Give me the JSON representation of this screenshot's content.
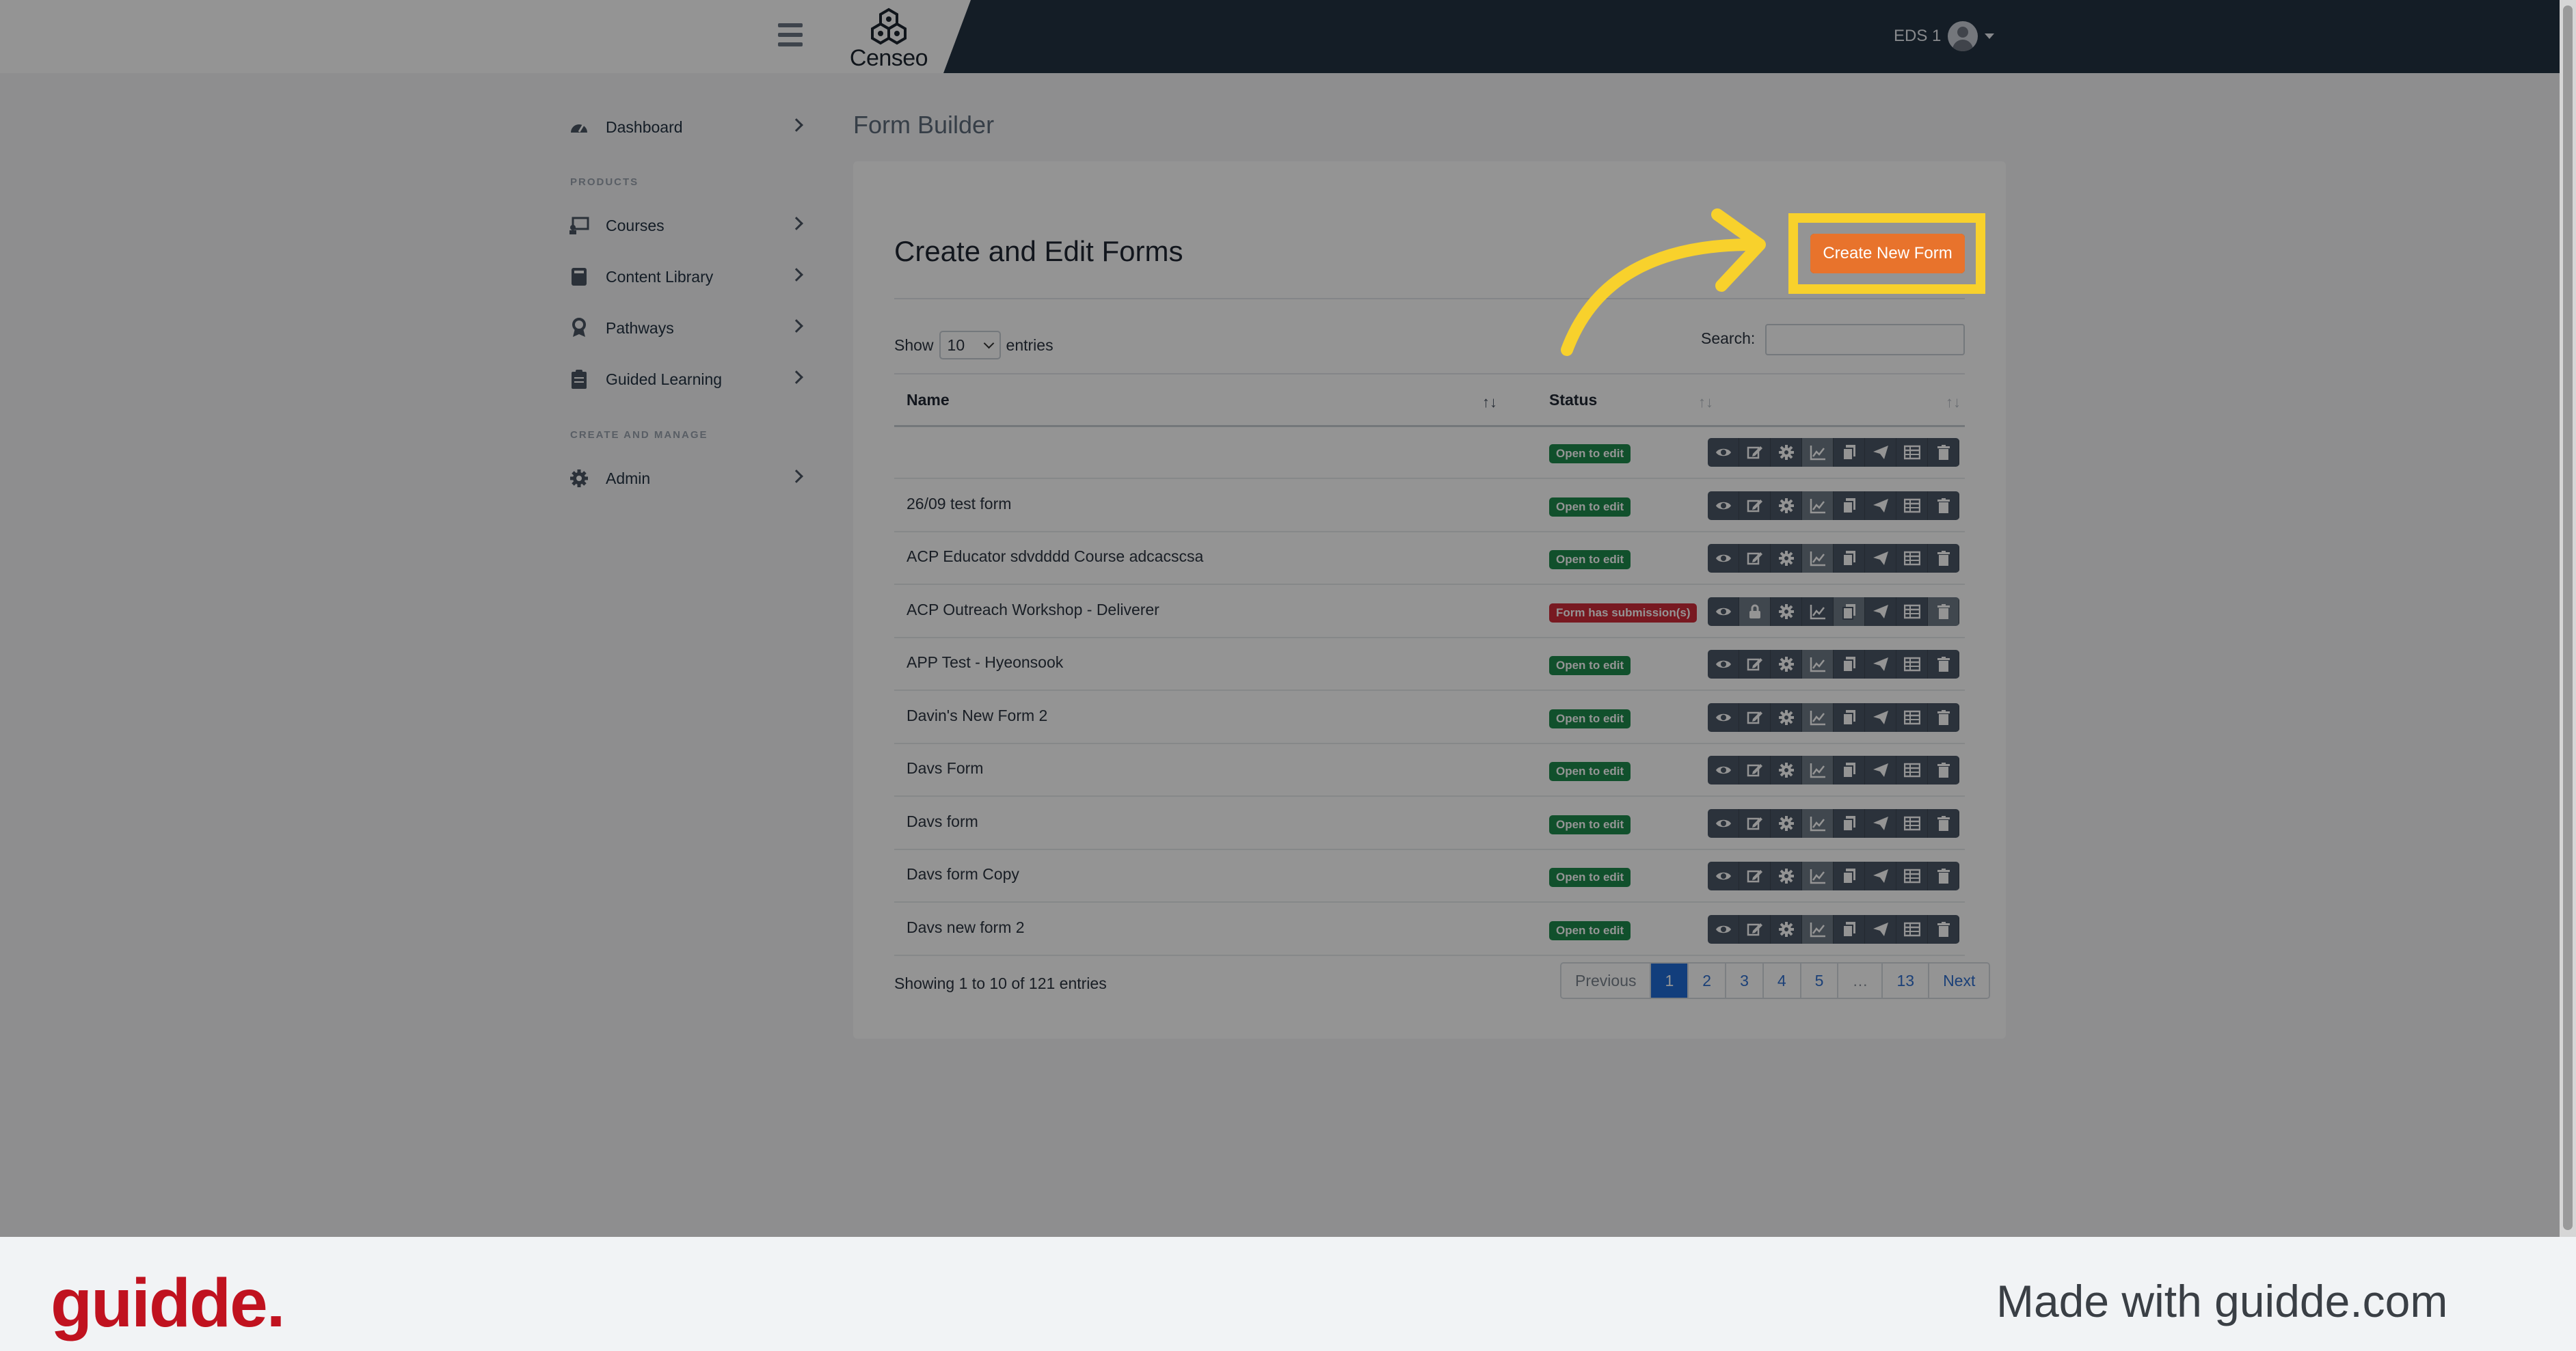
{
  "header": {
    "app_name": "Censeo",
    "user_name": "EDS 1"
  },
  "sidebar": {
    "items": [
      {
        "label": "Dashboard",
        "icon": "dashboard-icon"
      },
      {
        "section": "PRODUCTS"
      },
      {
        "label": "Courses",
        "icon": "courses-icon"
      },
      {
        "label": "Content Library",
        "icon": "book-icon"
      },
      {
        "label": "Pathways",
        "icon": "award-icon"
      },
      {
        "label": "Guided Learning",
        "icon": "clipboard-icon"
      },
      {
        "section": "CREATE AND MANAGE"
      },
      {
        "label": "Admin",
        "icon": "gear-icon"
      }
    ]
  },
  "page": {
    "title": "Form Builder"
  },
  "card": {
    "title": "Create and Edit Forms",
    "create_button": "Create New Form",
    "show_label": "Show",
    "entries_value": "10",
    "entries_label": "entries",
    "search_label": "Search:",
    "columns": [
      "Name",
      "Status"
    ],
    "rows": [
      {
        "name": "",
        "status": "Open to edit"
      },
      {
        "name": "26/09 test form",
        "status": "Open to edit"
      },
      {
        "name": "ACP Educator sdvdddd Course adcacscsa",
        "status": "Open to edit"
      },
      {
        "name": "ACP Outreach Workshop - Deliverer",
        "status": "Form has submission(s)"
      },
      {
        "name": "APP Test - Hyeonsook",
        "status": "Open to edit"
      },
      {
        "name": "Davin's New Form 2",
        "status": "Open to edit"
      },
      {
        "name": "Davs Form",
        "status": "Open to edit"
      },
      {
        "name": "Davs form",
        "status": "Open to edit"
      },
      {
        "name": "Davs form Copy",
        "status": "Open to edit"
      },
      {
        "name": "Davs new form 2",
        "status": "Open to edit"
      }
    ],
    "info": "Showing 1 to 10 of 121 entries",
    "pagination": [
      "Previous",
      "1",
      "2",
      "3",
      "4",
      "5",
      "…",
      "13",
      "Next"
    ]
  },
  "footer": {
    "brand": "guidde.",
    "made_with": "Made with guidde.com"
  },
  "colors": {
    "accent": "#e8732c",
    "nav": "#243243",
    "success": "#1e8a4c",
    "danger": "#cf2b3a",
    "highlight": "#f8d12c",
    "brand": "#c0121f"
  }
}
